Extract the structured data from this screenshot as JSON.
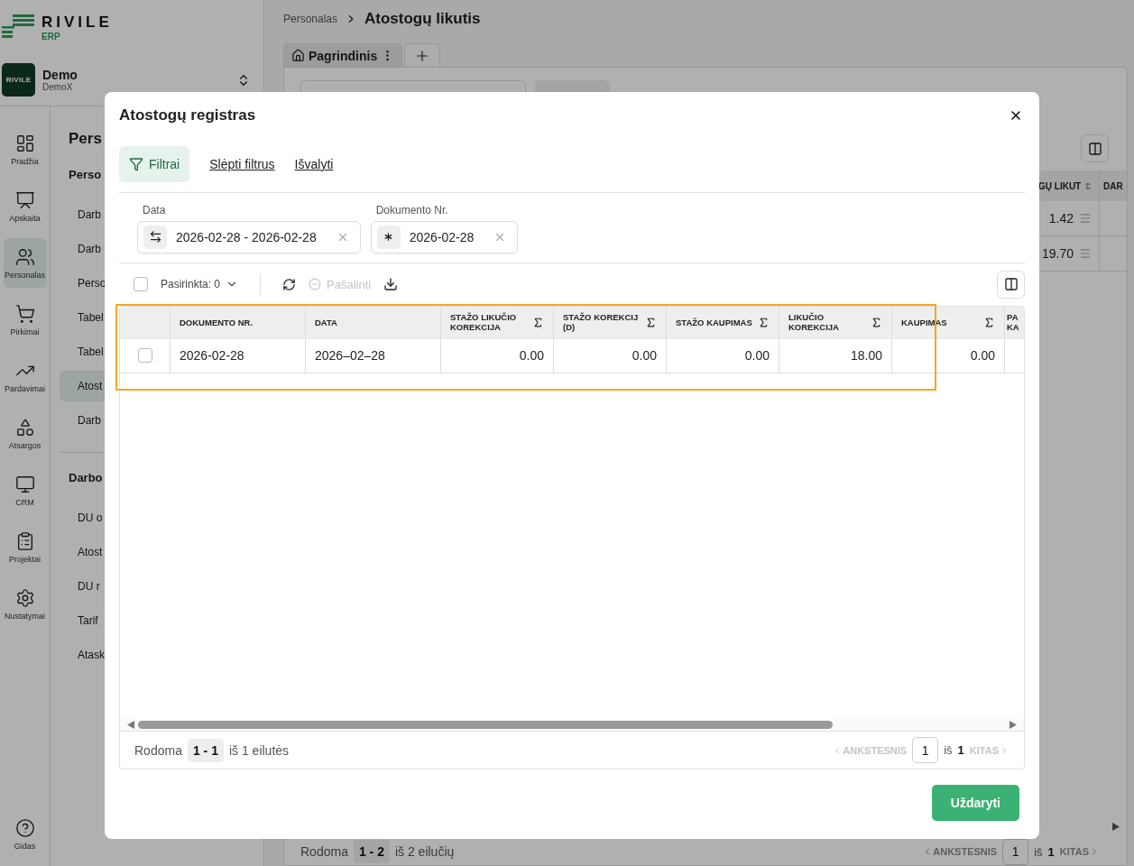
{
  "sidebar": {
    "logo": {
      "name": "RIVILE",
      "sub": "ERP"
    },
    "company": {
      "badge": "RIVILE",
      "name": "Demo",
      "sub": "DemoX"
    },
    "rail": [
      {
        "label": "Pradžia",
        "selected": false
      },
      {
        "label": "Apskaita",
        "selected": false
      },
      {
        "label": "Personalas",
        "selected": true
      },
      {
        "label": "Pirkimai",
        "selected": false
      },
      {
        "label": "Pardavimai",
        "selected": false
      },
      {
        "label": "Atsargos",
        "selected": false
      },
      {
        "label": "CRM",
        "selected": false
      },
      {
        "label": "Projektai",
        "selected": false
      },
      {
        "label": "Nustatymai",
        "selected": false
      }
    ],
    "help": {
      "label": "Gidas"
    }
  },
  "section_nav": {
    "title": "Pers",
    "groups": [
      {
        "title": "Perso",
        "items": [
          {
            "label": "Darb",
            "selected": false
          },
          {
            "label": "Darb",
            "selected": false
          },
          {
            "label": "Perso",
            "selected": false
          },
          {
            "label": "Tabel",
            "selected": false
          },
          {
            "label": "Tabel",
            "selected": false
          },
          {
            "label": "Atost",
            "selected": true
          },
          {
            "label": "Darb",
            "selected": false
          }
        ]
      },
      {
        "title": "Darbo",
        "items": [
          {
            "label": "DU o",
            "selected": false
          },
          {
            "label": "Atost",
            "selected": false
          },
          {
            "label": "DU r",
            "selected": false
          },
          {
            "label": "Tarif",
            "selected": false
          },
          {
            "label": "Atask",
            "selected": false
          }
        ]
      }
    ]
  },
  "breadcrumb": {
    "parent": "Personalas",
    "current": "Atostogų likutis"
  },
  "page_tabs": [
    {
      "label": "Pagrindinis",
      "selected": true
    }
  ],
  "background_table": {
    "columns": [
      "GŲ LIKUT",
      "DAR"
    ],
    "rows": [
      [
        "1.42"
      ],
      [
        "19.70"
      ]
    ]
  },
  "background_footer": {
    "prefix": "Rodoma",
    "range": "1 - 2",
    "total": "iš 2 eilučių",
    "prev": "ANKSTESNIS",
    "page": "1",
    "of": "iš",
    "pages": "1",
    "next": "KITAS"
  },
  "dialog": {
    "title": "Atostogų registras",
    "filter_button": "Filtrai",
    "links": [
      "Slėpti filtrus",
      "Išvalyti"
    ],
    "filters": [
      {
        "label": "Data",
        "value": "2026-02-28 - 2026-02-28",
        "kind": "range"
      },
      {
        "label": "Dokumento Nr.",
        "value": "2026-02-28",
        "kind": "text"
      }
    ],
    "toolbar": {
      "select_all": {
        "checked": false
      },
      "selected_count": "Pasirinkta: 0",
      "remove": {
        "label": "Pašalinti",
        "disabled": true
      }
    },
    "table": {
      "columns": [
        {
          "label": "DOKUMENTO NR.",
          "sum": false
        },
        {
          "label": "DATA",
          "sum": false
        },
        {
          "label": "STAŽO LIKUČIO KOREKCIJA",
          "sum": true
        },
        {
          "label": "STAŽO KOREKCIJ (D)",
          "sum": true
        },
        {
          "label": "STAŽO KAUPIMAS",
          "sum": true
        },
        {
          "label": "LIKUČIO KOREKCIJA",
          "sum": true
        },
        {
          "label": "KAUPIMAS",
          "sum": true
        },
        {
          "label": "PA KA",
          "sum": false
        }
      ],
      "rows": [
        {
          "checked": false,
          "highlighted": true,
          "cells": [
            "2026-02-28",
            "2026–02–28",
            "0.00",
            "0.00",
            "0.00",
            "18.00",
            "0.00"
          ]
        }
      ]
    },
    "footer": {
      "prefix": "Rodoma",
      "range": "1 - 1",
      "total": "iš 1 eilutės",
      "prev": "ANKSTESNIS",
      "page": "1",
      "of": "iš",
      "pages": "1",
      "next": "KITAS"
    },
    "close_button": "Uždaryti"
  }
}
